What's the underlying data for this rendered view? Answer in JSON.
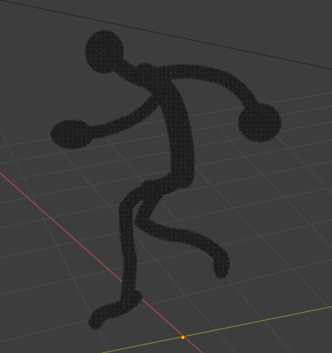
{
  "viewport": {
    "background_color": "#3d3d3d",
    "grid_color": "#4a4a4a",
    "x_axis_color": "#a84a4f",
    "y_axis_color": "#6e8a34",
    "origin_color": "#f5a623",
    "mesh_color": "#1f1f1f",
    "mesh_speckle_color": "#2c2c2c",
    "mesh_description_icon": "particle-mesh-humanoid",
    "horizon_line_color": "#262626"
  }
}
